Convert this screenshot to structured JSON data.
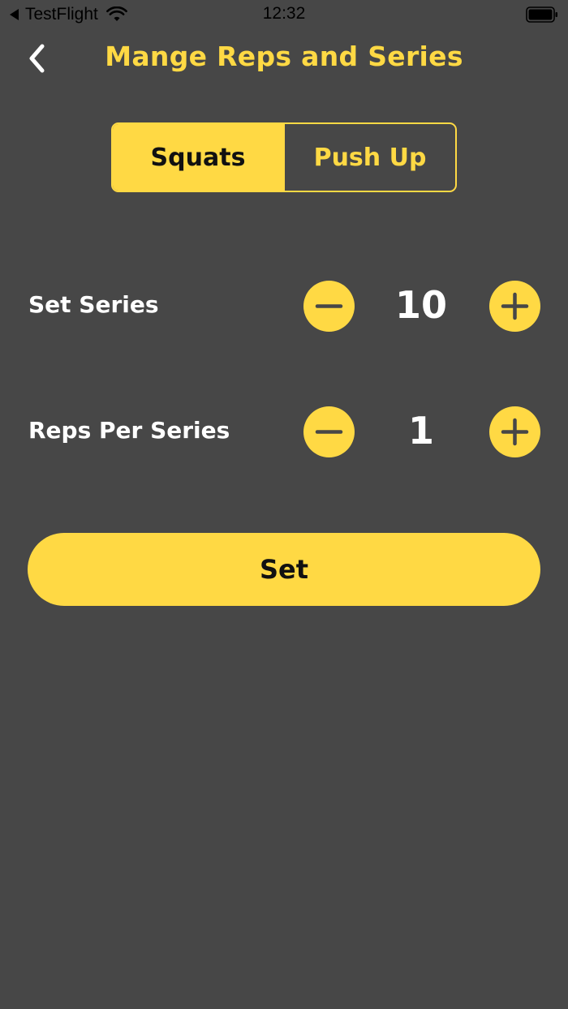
{
  "status_bar": {
    "back_app": "TestFlight",
    "time": "12:32"
  },
  "nav": {
    "title": "Mange Reps and Series"
  },
  "segments": [
    {
      "label": "Squats",
      "selected": true
    },
    {
      "label": "Push Up",
      "selected": false
    }
  ],
  "rows": {
    "series": {
      "label": "Set Series",
      "value": "10"
    },
    "reps": {
      "label": "Reps Per Series",
      "value": "1"
    }
  },
  "action": {
    "set_label": "Set"
  },
  "colors": {
    "background": "#474747",
    "accent": "#FFD944",
    "text": "#FFFFFF"
  },
  "icons": {
    "back": "chevron-left-icon",
    "minus": "minus-icon",
    "plus": "plus-icon",
    "wifi": "wifi-icon",
    "battery": "battery-icon"
  }
}
